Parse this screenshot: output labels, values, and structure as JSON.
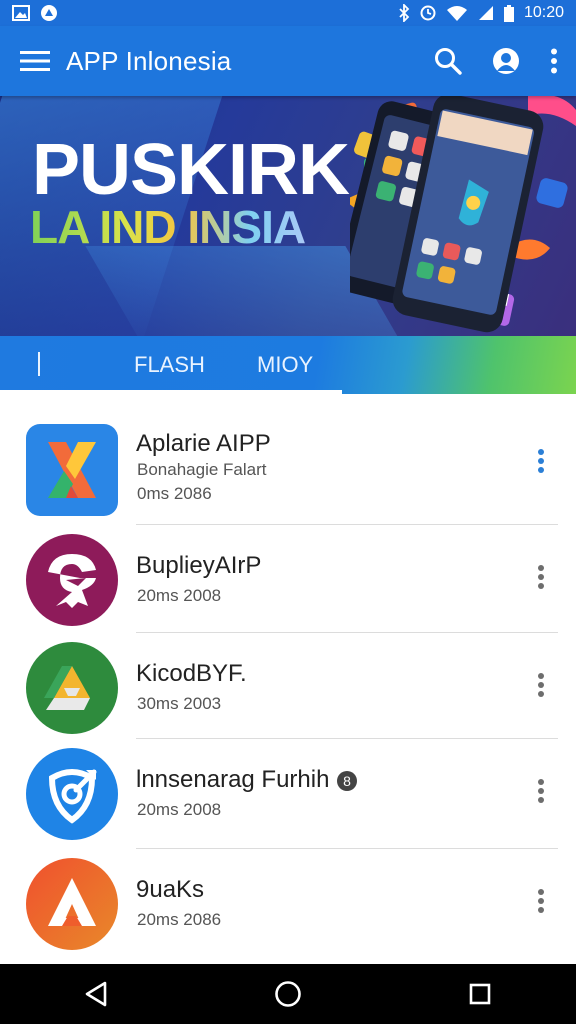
{
  "status_bar": {
    "time": "10:20"
  },
  "app_bar": {
    "title": "APP Inlonesia"
  },
  "banner": {
    "headline": "PUSKIRK",
    "subheadline": "LA IND INSIA"
  },
  "tabs": [
    {
      "label": "FLASH"
    },
    {
      "label": "MIOY"
    }
  ],
  "apps": [
    {
      "name": "Aplarie AIPP",
      "publisher": "Bonahagie Falart",
      "date": "0ms 2086",
      "icon": "x-logo-icon"
    },
    {
      "name": "BuplieyAIrP",
      "date": "20ms 2008",
      "icon": "mask-logo-icon"
    },
    {
      "name": "KicodBYF.",
      "date": "30ms 2003",
      "icon": "drive-triangle-icon"
    },
    {
      "name": "lnnsenarag Furhih",
      "date": "20ms 2008",
      "icon": "shield-logo-icon"
    },
    {
      "name": "9uaKs",
      "date": "20ms 2086",
      "icon": "a-logo-icon"
    }
  ],
  "colors": {
    "primary": "#1e76dd",
    "status": "#1d6fd8",
    "accent_more": "#2b7fd6"
  }
}
